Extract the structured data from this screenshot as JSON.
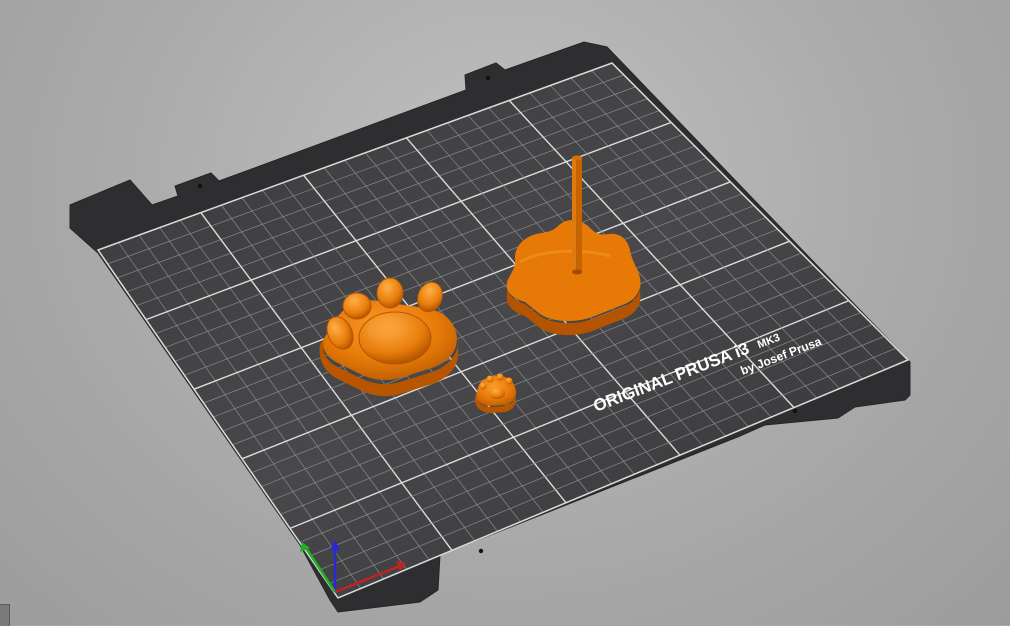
{
  "viewport": {
    "background": "#a7a7a7",
    "model_color": "#e07000"
  },
  "bed": {
    "brand_line_1": "ORIGINAL PRUSA i3",
    "brand_model": "MK3",
    "brand_line_2": "by Josef Prusa",
    "surface_color": "#3b3b3d",
    "grid_color": "#b8b8b8"
  },
  "objects": [
    {
      "name": "large paw"
    },
    {
      "name": "small paw"
    },
    {
      "name": "paw with pin"
    }
  ],
  "axes": {
    "x_color": "#c42222",
    "y_color": "#22b022",
    "z_color": "#2828d8"
  }
}
